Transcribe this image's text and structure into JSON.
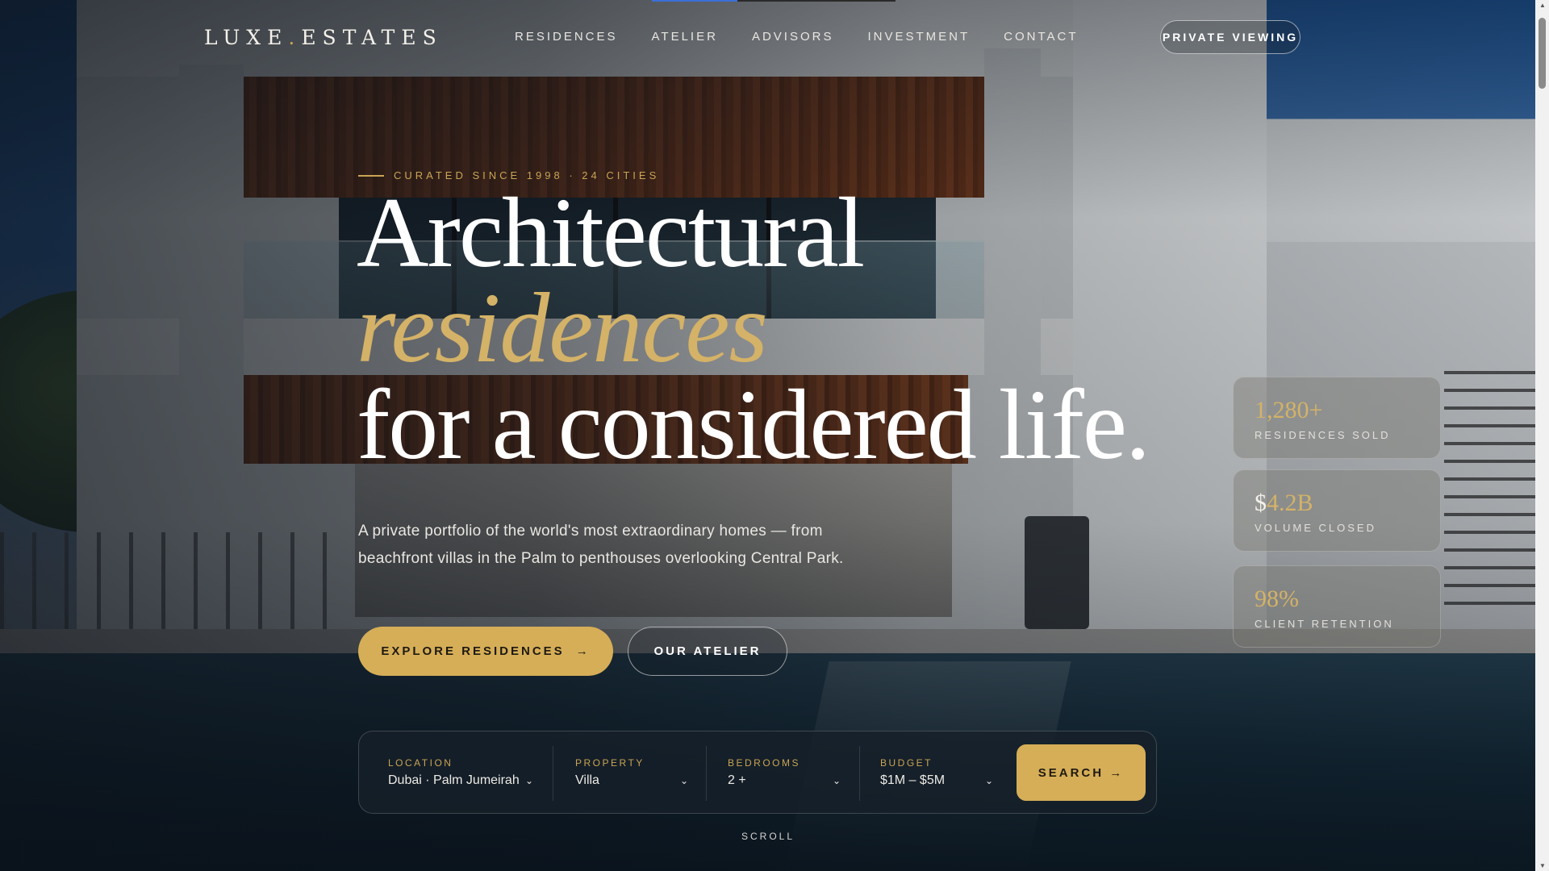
{
  "brand": {
    "name_left": "LUXE",
    "dot": ".",
    "name_right": "ESTATES"
  },
  "nav": {
    "items": [
      "RESIDENCES",
      "ATELIER",
      "ADVISORS",
      "INVESTMENT",
      "CONTACT"
    ]
  },
  "header": {
    "cta_label": "PRIVATE VIEWING"
  },
  "hero": {
    "eyebrow": "CURATED SINCE 1998 · 24 CITIES",
    "headline_1": "Architectural",
    "headline_2": "residences",
    "headline_3": "for a considered life.",
    "subtitle": "A private portfolio of the world's most extraordinary homes — from beachfront villas in the Palm to penthouses overlooking Central Park.",
    "primary_cta": "EXPLORE RESIDENCES",
    "primary_cta_arrow": "→",
    "secondary_cta": "OUR ATELIER"
  },
  "stats": [
    {
      "prefix": "",
      "value": "1,280+",
      "label": "RESIDENCES SOLD"
    },
    {
      "prefix": "$",
      "value": "4.2B",
      "label": "VOLUME CLOSED"
    },
    {
      "prefix": "",
      "value": "98%",
      "label": "CLIENT RETENTION"
    }
  ],
  "search": {
    "location": {
      "label": "LOCATION",
      "value": "Dubai · Palm Jumeirah"
    },
    "property": {
      "label": "PROPERTY",
      "value": "Villa"
    },
    "bedrooms": {
      "label": "BEDROOMS",
      "value": "2 +"
    },
    "budget": {
      "label": "BUDGET",
      "value": "$1M – $5M"
    },
    "button_label": "SEARCH →",
    "chevron": "⌄"
  },
  "scroll_hint": "SCROLL",
  "colors": {
    "accent_gold": "#d6ae58",
    "gold_text": "#caa454",
    "panel": "#16202a"
  },
  "page_progress": 0.35
}
